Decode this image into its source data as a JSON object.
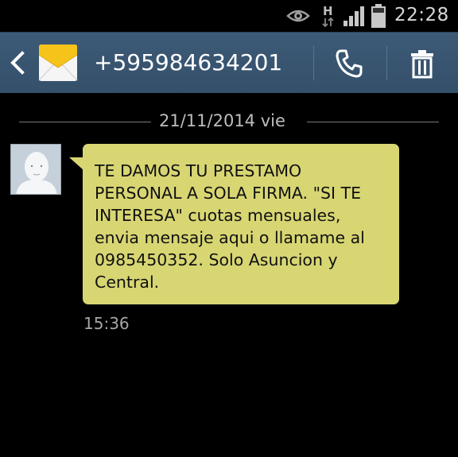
{
  "status_bar": {
    "time": "22:28",
    "network_type": "H",
    "icons": [
      "eye-icon",
      "h-network-icon",
      "signal-icon",
      "battery-icon"
    ]
  },
  "header": {
    "contact": "+595984634201",
    "icons": [
      "back-icon",
      "envelope-icon",
      "call-icon",
      "delete-icon"
    ]
  },
  "conversation": {
    "date": "21/11/2014 vie",
    "messages": [
      {
        "text": "TE DAMOS TU PRESTAMO\nPERSONAL A SOLA FIRMA. \"SI TE\nINTERESA\" cuotas mensuales,\nenvia mensaje aqui o llamame al\n0985450352. Solo Asuncion y\nCentral.",
        "time": "15:36"
      }
    ]
  },
  "colors": {
    "header_bg": "#3d5a76",
    "bubble_bg": "#d8d673",
    "background": "#000000",
    "envelope_yellow": "#f6c31b"
  }
}
